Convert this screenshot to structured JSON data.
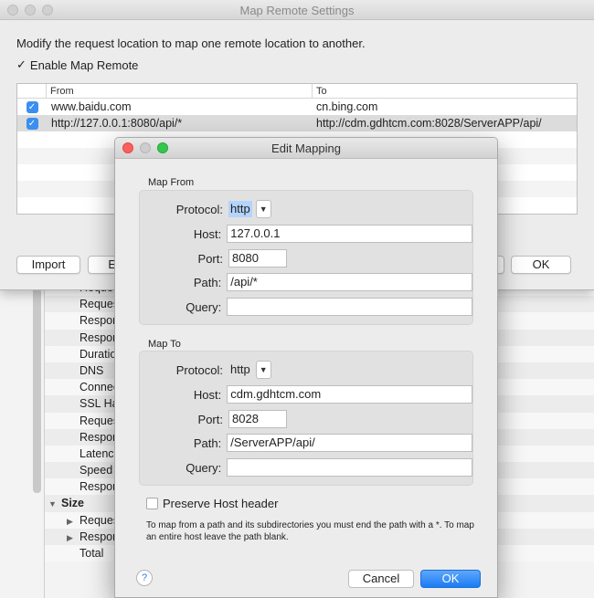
{
  "settings_window": {
    "title": "Map Remote Settings",
    "intro": "Modify the request location to map one remote location to another.",
    "enable_label": "Enable Map Remote",
    "enable_checked": true,
    "columns": {
      "from": "From",
      "to": "To"
    },
    "rows": [
      {
        "enabled": true,
        "from": "www.baidu.com",
        "to": "cn.bing.com"
      },
      {
        "enabled": true,
        "from": "http://127.0.0.1:8080/api/*",
        "to": "http://cdm.gdhtcm.com:8028/ServerAPP/api/"
      }
    ],
    "buttons": {
      "import": "Import",
      "export": "Ex",
      "ok": "OK"
    }
  },
  "background_tree": {
    "rows": [
      {
        "label": "Reques",
        "level": 1
      },
      {
        "label": "Reques",
        "level": 1
      },
      {
        "label": "Respon",
        "level": 1
      },
      {
        "label": "Respon",
        "level": 1
      },
      {
        "label": "Duratio",
        "level": 1
      },
      {
        "label": "DNS",
        "level": 1
      },
      {
        "label": "Connec",
        "level": 1
      },
      {
        "label": "SSL Ha",
        "level": 1
      },
      {
        "label": "Reques",
        "level": 1
      },
      {
        "label": "Respon",
        "level": 1
      },
      {
        "label": "Latenc",
        "level": 1
      },
      {
        "label": "Speed",
        "level": 1
      },
      {
        "label": "Respon",
        "level": 1
      },
      {
        "label": "Size",
        "level": 0,
        "expanded": true
      },
      {
        "label": "Reques",
        "level": 2,
        "expanded": false
      },
      {
        "label": "Respon",
        "level": 2,
        "expanded": false
      },
      {
        "label": "Total",
        "level": 1
      }
    ]
  },
  "dialog": {
    "title": "Edit Mapping",
    "map_from": {
      "label": "Map From",
      "protocol_label": "Protocol:",
      "protocol": "http",
      "host_label": "Host:",
      "host": "127.0.0.1",
      "port_label": "Port:",
      "port": "8080",
      "path_label": "Path:",
      "path": "/api/*",
      "query_label": "Query:",
      "query": ""
    },
    "map_to": {
      "label": "Map To",
      "protocol_label": "Protocol:",
      "protocol": "http",
      "host_label": "Host:",
      "host": "cdm.gdhtcm.com",
      "port_label": "Port:",
      "port": "8028",
      "path_label": "Path:",
      "path": "/ServerAPP/api/",
      "query_label": "Query:",
      "query": ""
    },
    "preserve_host_label": "Preserve Host header",
    "preserve_host_checked": false,
    "note": "To map from a path and its subdirectories you must end the path with a *. To map an entire host leave the path blank.",
    "help": "?",
    "cancel": "Cancel",
    "ok": "OK"
  }
}
